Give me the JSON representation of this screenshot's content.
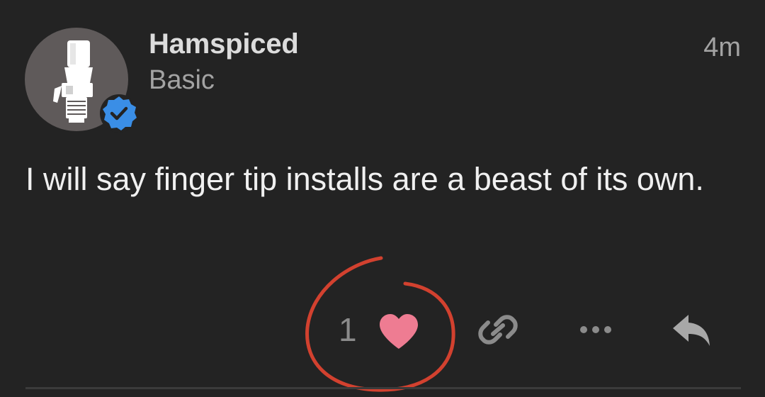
{
  "post": {
    "author": {
      "name": "Hamspiced",
      "level": "Basic",
      "verified": true
    },
    "time_ago": "4m",
    "body": "I will say finger tip installs are a beast of its own.",
    "likes": {
      "count": "1",
      "liked": true
    },
    "icons": {
      "avatar": "rj45-connector-avatar",
      "verified": "verified-badge-icon",
      "like": "heart-icon",
      "link": "link-icon",
      "more": "ellipsis-icon",
      "reply": "reply-arrow-icon"
    }
  },
  "colors": {
    "background": "#232323",
    "heart": "#ee7c92",
    "verified_badge": "#3a8ee6",
    "annotation": "#d2412f",
    "muted_text": "#a3a3a3"
  }
}
